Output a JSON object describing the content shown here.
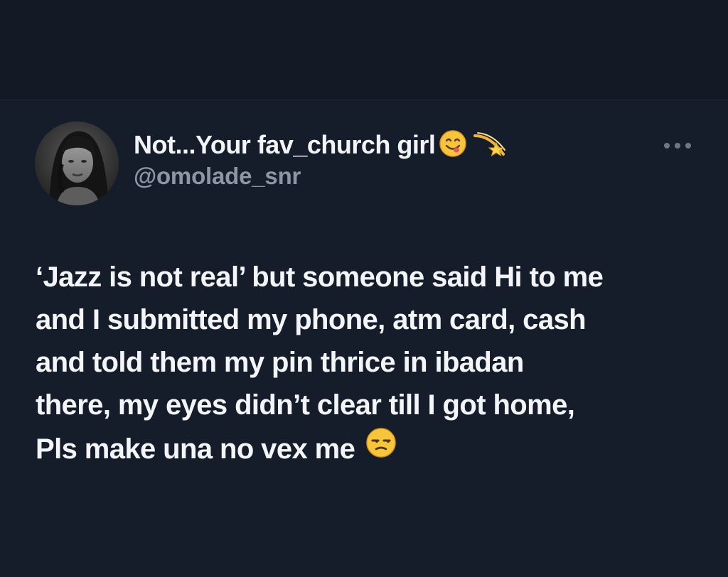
{
  "tweet": {
    "display_name": "Not...Your fav_church girl",
    "name_emojis": [
      "yum-face-icon",
      "dizzy-star-icon"
    ],
    "handle": "@omolade_snr",
    "text_lines": [
      "‘Jazz is not real’ but someone said Hi to me",
      "and I submitted my phone, atm card, cash",
      "and told them my pin thrice in ibadan",
      "there, my eyes didn’t clear till I got home,",
      "Pls make una no vex me"
    ],
    "text_end_emoji": "unamused-face-icon",
    "more_menu_icon": "more-options-icon"
  },
  "colors": {
    "background": "#161d2a",
    "text_primary": "#f3f5f8",
    "text_secondary": "#8b97a6"
  }
}
